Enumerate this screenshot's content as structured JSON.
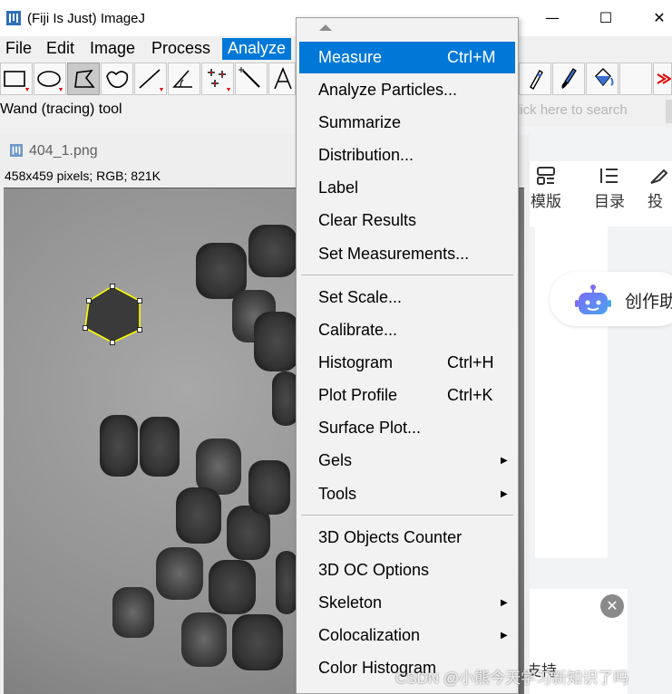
{
  "window": {
    "title": "(Fiji Is Just) ImageJ",
    "minimize": "—",
    "maximize": "☐",
    "close": "✕"
  },
  "menubar": {
    "items": [
      "File",
      "Edit",
      "Image",
      "Process",
      "Analyze"
    ],
    "active": "Analyze"
  },
  "toolbar": {
    "status": "Wand (tracing) tool",
    "search_placeholder": "lick here to search",
    "tools": [
      "rectangle-tool",
      "oval-tool",
      "polygon-tool",
      "freehand-tool",
      "line-tool",
      "angle-tool",
      "point-tool",
      "wand-tool",
      "text-tool"
    ],
    "selected_tool": "polygon-tool"
  },
  "image_window": {
    "title": "404_1.png",
    "info": "458x459 pixels; RGB; 821K"
  },
  "analyze_menu": {
    "items": [
      {
        "label": "Measure",
        "shortcut": "Ctrl+M",
        "highlighted": true
      },
      {
        "label": "Analyze Particles..."
      },
      {
        "label": "Summarize"
      },
      {
        "label": "Distribution..."
      },
      {
        "label": "Label"
      },
      {
        "label": "Clear Results"
      },
      {
        "label": "Set Measurements..."
      },
      {
        "separator": true
      },
      {
        "label": "Set Scale..."
      },
      {
        "label": "Calibrate..."
      },
      {
        "label": "Histogram",
        "shortcut": "Ctrl+H"
      },
      {
        "label": "Plot Profile",
        "shortcut": "Ctrl+K"
      },
      {
        "label": "Surface Plot..."
      },
      {
        "label": "Gels",
        "submenu": true
      },
      {
        "label": "Tools",
        "submenu": true
      },
      {
        "separator": true
      },
      {
        "label": "3D Objects Counter"
      },
      {
        "label": "3D OC Options"
      },
      {
        "label": "Skeleton",
        "submenu": true
      },
      {
        "label": "Colocalization",
        "submenu": true
      },
      {
        "label": "Color Histogram"
      }
    ],
    "submenu_arrow": "▶"
  },
  "browser": {
    "nav": [
      {
        "icon": "template-icon",
        "label": "模版"
      },
      {
        "icon": "list-icon",
        "label": "目录"
      },
      {
        "icon": "publish-icon",
        "label": "投"
      }
    ],
    "chat_label": "创作助",
    "close_glyph": "✕",
    "support_text": "支持"
  },
  "watermark": "CSDN @小熊今天学习新知识了吗",
  "colors": {
    "accent": "#0078d7",
    "roi_outline": "#ffff00",
    "menu_bg": "#f2f2f2"
  }
}
